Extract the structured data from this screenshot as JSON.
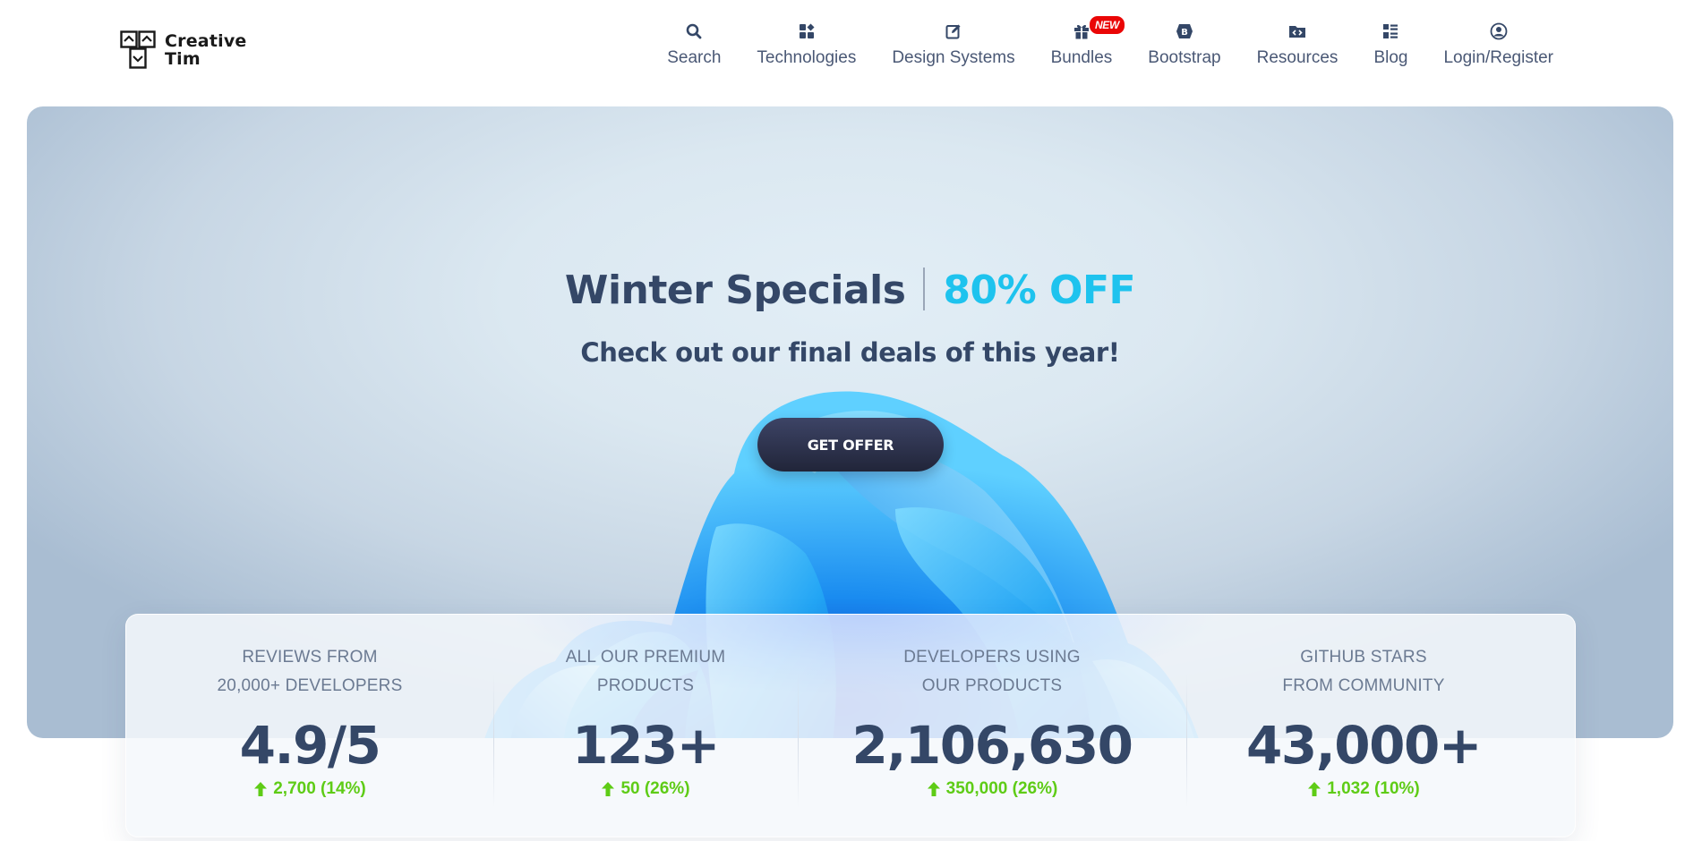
{
  "brand": {
    "line1": "Creative",
    "line2": "Tim"
  },
  "nav": {
    "items": [
      {
        "label": "Search",
        "icon": "search-icon"
      },
      {
        "label": "Technologies",
        "icon": "grid-icon"
      },
      {
        "label": "Design Systems",
        "icon": "edit-icon"
      },
      {
        "label": "Bundles",
        "icon": "gift-icon",
        "badge": "NEW"
      },
      {
        "label": "Bootstrap",
        "icon": "bootstrap-icon"
      },
      {
        "label": "Resources",
        "icon": "code-folder-icon"
      },
      {
        "label": "Blog",
        "icon": "list-icon"
      },
      {
        "label": "Login/Register",
        "icon": "user-circle-icon"
      }
    ]
  },
  "hero": {
    "title": "Winter Specials",
    "discount": "80% OFF",
    "subtitle": "Check out our final deals of this year!",
    "cta": "GET OFFER"
  },
  "stats": [
    {
      "label_line1": "REVIEWS FROM",
      "label_line2": "20,000+ DEVELOPERS",
      "value": "4.9/5",
      "delta": "2,700 (14%)"
    },
    {
      "label_line1": "ALL OUR PREMIUM",
      "label_line2": "PRODUCTS",
      "value": "123+",
      "delta": "50 (26%)"
    },
    {
      "label_line1": "DEVELOPERS USING",
      "label_line2": "OUR PRODUCTS",
      "value": "2,106,630",
      "delta": "350,000 (26%)"
    },
    {
      "label_line1": "GITHUB STARS",
      "label_line2": "FROM COMMUNITY",
      "value": "43,000+",
      "delta": "1,032 (10%)"
    }
  ],
  "colors": {
    "primary_text": "#344767",
    "accent_cyan": "#1ec3ee",
    "success_green": "#5ecc16",
    "badge_red": "#ea0606"
  }
}
